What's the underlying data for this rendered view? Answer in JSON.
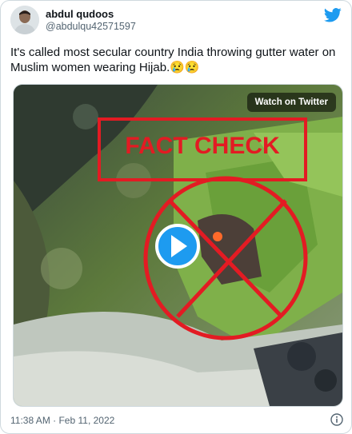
{
  "tweet": {
    "author_name": "abdul qudoos",
    "author_handle": "@abdulqu42571597",
    "text": "It's called most secular country India throwing gutter water  on Muslim women wearing Hijab.😢😢",
    "timestamp": "11:38 AM · Feb 11, 2022"
  },
  "media": {
    "watch_label": "Watch on Twitter",
    "overlay_stamp": "FACT CHECK",
    "stamp_color": "#e31b23"
  },
  "colors": {
    "twitter_blue": "#1d9bf0",
    "text_primary": "#0f1419",
    "text_secondary": "#536471",
    "border": "#cfd9de"
  },
  "icons": {
    "logo": "twitter-bird-icon",
    "play": "play-icon",
    "info": "info-icon"
  }
}
